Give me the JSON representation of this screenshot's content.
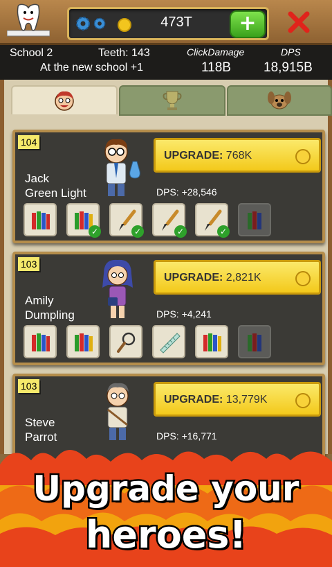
{
  "header": {
    "currency_value": "473T",
    "add_label": "+",
    "close_label": "×"
  },
  "stats": {
    "school_label": "School  2",
    "teeth_label": "Teeth: 143",
    "click_damage_label": "ClickDamage",
    "dps_label": "DPS",
    "subtitle": "At the new school +1",
    "click_damage_value": "118B",
    "dps_value": "18,915B"
  },
  "tabs": [
    {
      "name": "heroes",
      "icon": "hero-face-icon",
      "active": true
    },
    {
      "name": "trophies",
      "icon": "trophy-icon",
      "active": false
    },
    {
      "name": "pets",
      "icon": "dog-icon",
      "active": false
    }
  ],
  "heroes": [
    {
      "level": "104",
      "name_line1": "Jack",
      "name_line2": "Green Light",
      "upgrade_label": "UPGRADE:",
      "upgrade_cost": "768K",
      "dps": "DPS: +28,546"
    },
    {
      "level": "103",
      "name_line1": "Amily",
      "name_line2": "Dumpling",
      "upgrade_label": "UPGRADE:",
      "upgrade_cost": "2,821K",
      "dps": "DPS: +4,241"
    },
    {
      "level": "103",
      "name_line1": "Steve",
      "name_line2": "Parrot",
      "upgrade_label": "UPGRADE:",
      "upgrade_cost": "13,779K",
      "dps": "DPS: +16,771"
    }
  ],
  "banner": {
    "line1": "Upgrade your",
    "line2": "heroes!"
  },
  "colors": {
    "upgrade_yellow": "#f3c91b",
    "card_dark": "#3b3a36",
    "plus_green": "#3aa21c",
    "close_red": "#e0231b"
  }
}
